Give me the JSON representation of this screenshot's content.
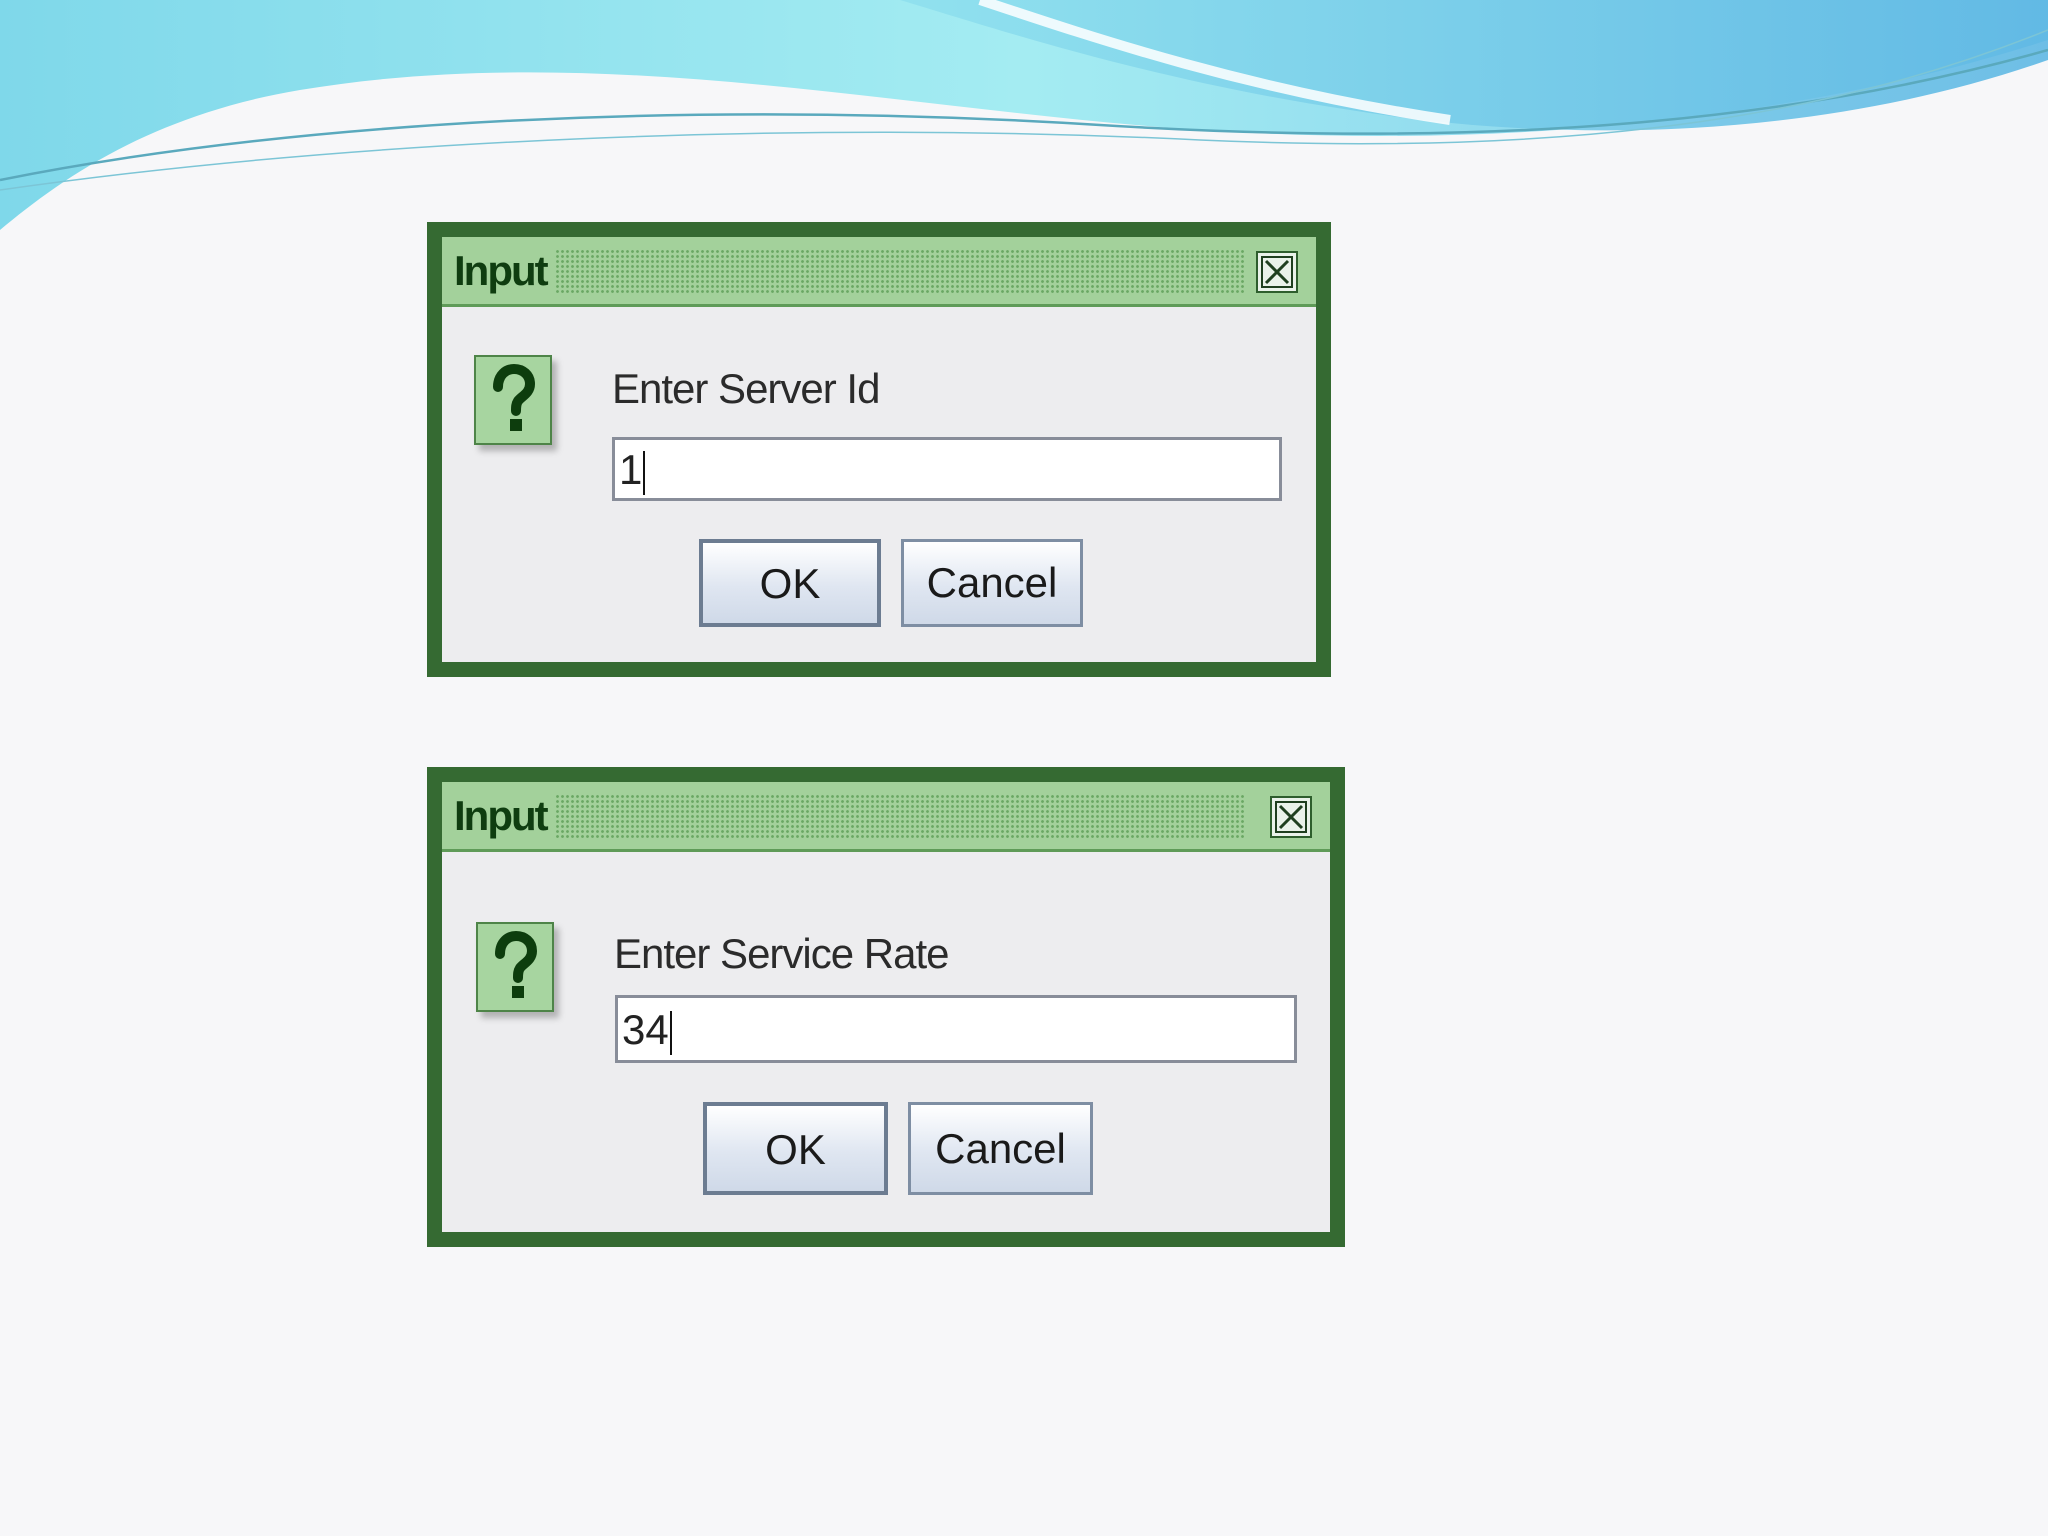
{
  "dialogs": [
    {
      "title": "Input",
      "prompt": "Enter Server Id",
      "input_value": "1",
      "ok_label": "OK",
      "cancel_label": "Cancel"
    },
    {
      "title": "Input",
      "prompt": "Enter Service Rate",
      "input_value": "34",
      "ok_label": "OK",
      "cancel_label": "Cancel"
    }
  ],
  "icons": {
    "question": "question-mark-icon",
    "close": "close-icon"
  },
  "colors": {
    "frame": "#356a32",
    "titlebar": "#a3d19b",
    "body": "#ededef"
  }
}
